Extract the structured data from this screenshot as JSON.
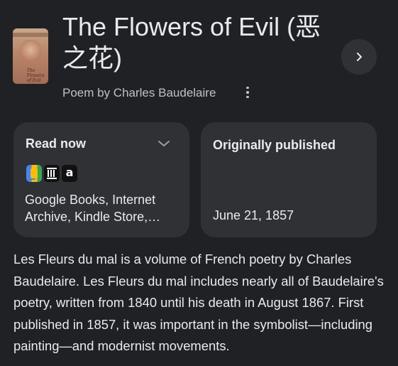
{
  "header": {
    "title": "The Flowers of Evil (恶之花)",
    "subtitle": "Poem by Charles Baudelaire",
    "thumbnail_text": "The Flowers of Evil"
  },
  "read_now": {
    "label": "Read now",
    "stores": [
      {
        "name": "Google Books",
        "icon": "google-books-icon"
      },
      {
        "name": "Internet Archive",
        "icon": "internet-archive-icon"
      },
      {
        "name": "Kindle Store",
        "icon": "amazon-kindle-icon"
      }
    ],
    "stores_line1": "Google Books, Internet",
    "stores_line2": "Archive, Kindle Store,…"
  },
  "originally_published": {
    "label": "Originally published",
    "value": "June 21, 1857"
  },
  "description": "Les Fleurs du mal is a volume of French poetry by Charles Baudelaire. Les Fleurs du mal includes nearly all of Baudelaire's poetry, written from 1840 until his death in August 1867. First published in 1857, it was important in the symbolist—including painting—and modernist movements.",
  "colors": {
    "background": "#202124",
    "card": "#303134",
    "text": "#e8eaed",
    "secondary_text": "#bdc1c6"
  }
}
